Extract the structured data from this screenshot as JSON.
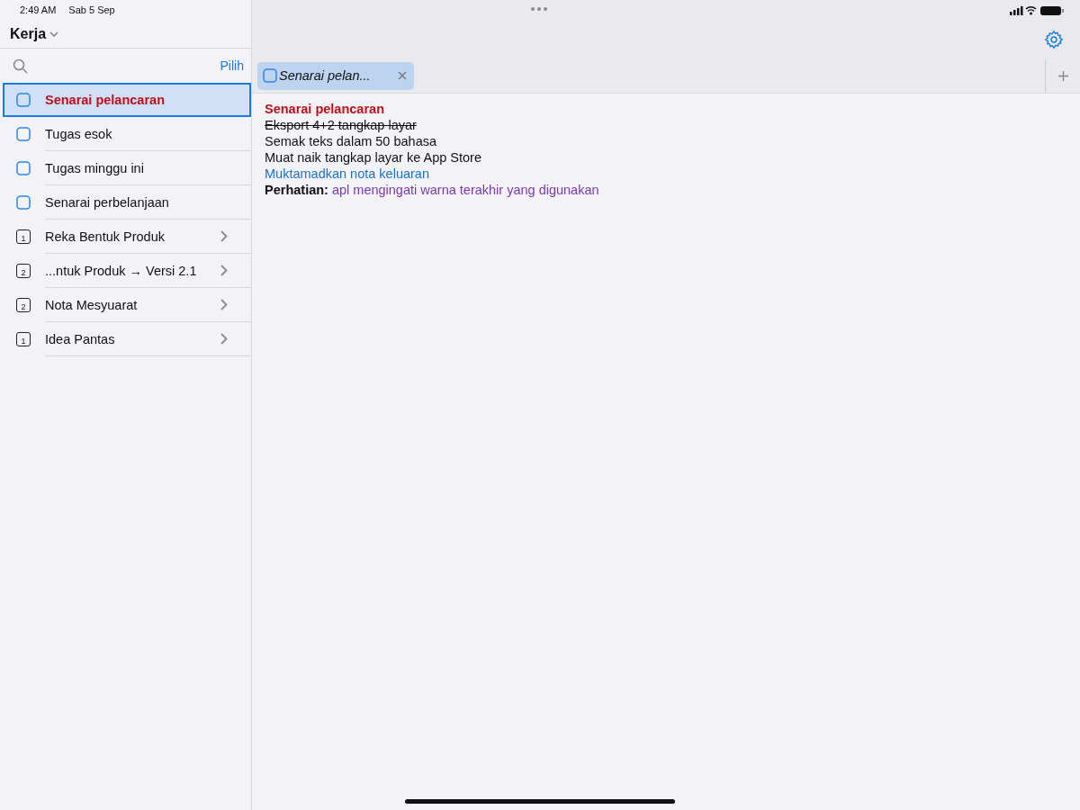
{
  "status_bar": {
    "time": "2:49 AM",
    "date": "Sab 5 Sep"
  },
  "sidebar": {
    "title": "Kerja",
    "select_label": "Pilih",
    "items": [
      {
        "kind": "note",
        "label": "Senarai pelancaran",
        "selected": true
      },
      {
        "kind": "note",
        "label": "Tugas esok",
        "selected": false
      },
      {
        "kind": "note",
        "label": "Tugas minggu ini",
        "selected": false
      },
      {
        "kind": "note",
        "label": "Senarai perbelanjaan",
        "selected": false
      },
      {
        "kind": "folder",
        "badge": "1",
        "label": "Reka Bentuk Produk",
        "selected": false
      },
      {
        "kind": "folder",
        "badge": "2",
        "label": "...ntuk Produk → Versi 2.1",
        "selected": false
      },
      {
        "kind": "folder",
        "badge": "2",
        "label": "Nota Mesyuarat",
        "selected": false
      },
      {
        "kind": "folder",
        "badge": "1",
        "label": "Idea Pantas",
        "selected": false
      }
    ]
  },
  "tabs": [
    {
      "label": "Senarai pelan...",
      "selected": true
    }
  ],
  "note": {
    "lines": [
      {
        "kind": "title",
        "text": "Senarai pelancaran",
        "color": "#c00f18"
      },
      {
        "kind": "done",
        "text": "Eksport 4+2 tangkap layar",
        "color": "#111111"
      },
      {
        "kind": "plain",
        "text": "Semak teks dalam 50 bahasa",
        "color": "#111111"
      },
      {
        "kind": "plain",
        "text": "Muat naik tangkap layar ke App Store",
        "color": "#111111"
      },
      {
        "kind": "plain",
        "text": "Muktamadkan nota keluaran",
        "color": "#1a73c9"
      },
      {
        "kind": "labeled",
        "label": "Perhatian:",
        "text": "apl mengingati warna terakhir yang digunakan",
        "color": "#7a3aa8"
      }
    ]
  }
}
